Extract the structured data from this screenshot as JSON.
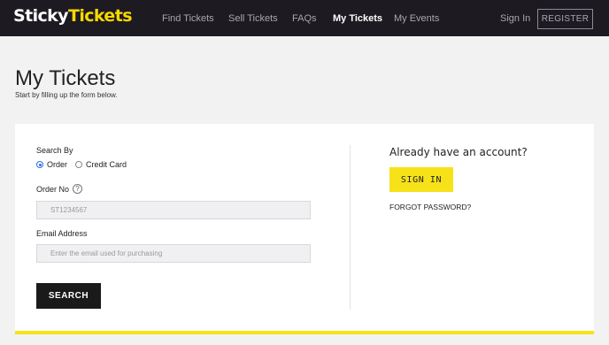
{
  "header": {
    "logo_part1": "Sticky",
    "logo_part2": "Tickets",
    "nav": [
      "Find Tickets",
      "Sell Tickets",
      "FAQs",
      "My Tickets",
      "My Events"
    ],
    "active_nav": "My Tickets",
    "signin_label": "Sign In",
    "register_label": "REGISTER"
  },
  "page": {
    "title": "My Tickets",
    "subtitle": "Start by filling up the form below."
  },
  "form": {
    "search_by_label": "Search By",
    "options": [
      "Order",
      "Credit Card"
    ],
    "selected_option": "Order",
    "order_no_label": "Order No",
    "help_glyph": "?",
    "order_no_placeholder": "ST1234567",
    "email_label": "Email Address",
    "email_placeholder": "Enter the email used for purchasing",
    "search_button": "SEARCH"
  },
  "account": {
    "question": "Already have an account?",
    "signin_button": "SIGN IN",
    "forgot_link": "FORGOT PASSWORD?"
  },
  "colors": {
    "header_bg": "#1e1a22",
    "accent_yellow": "#f7e21a",
    "radio_blue": "#2a6ee8"
  }
}
